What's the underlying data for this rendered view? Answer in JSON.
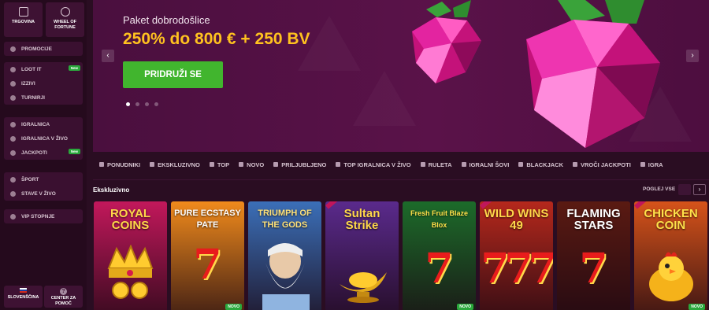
{
  "sidebar": {
    "top_tiles": [
      "TRGOVINA",
      "WHEEL OF FORTUNE"
    ],
    "groups": [
      [
        {
          "label": "PROMOCIJE",
          "icon": "gift-icon"
        }
      ],
      [
        {
          "label": "LOOT IT",
          "icon": "chest-icon",
          "badge": "New"
        },
        {
          "label": "IZZIVI",
          "icon": "target-icon"
        },
        {
          "label": "TURNIRJI",
          "icon": "trophy-icon"
        }
      ],
      [
        {
          "label": "IGRALNICA",
          "icon": "cards-icon"
        },
        {
          "label": "IGRALNICA V ŽIVO",
          "icon": "live-icon"
        },
        {
          "label": "JACKPOTI",
          "icon": "coins-icon",
          "badge": "New"
        }
      ],
      [
        {
          "label": "ŠPORT",
          "icon": "ball-icon"
        },
        {
          "label": "STAVE V ŽIVO",
          "icon": "timer-icon"
        }
      ],
      [
        {
          "label": "VIP STOPNJE",
          "icon": "crown-icon"
        }
      ]
    ],
    "language": "SLOVENŠČINA",
    "help": "CENTER ZA POMOČ"
  },
  "banner": {
    "subtitle": "Paket dobrodošlice",
    "title": "250% do 800 € + 250 BV",
    "cta": "PRIDRUŽI SE",
    "slides": 4,
    "active_slide": 1
  },
  "categories": [
    "PONUDNIKI",
    "EKSKLUZIVNO",
    "TOP",
    "NOVO",
    "PRILJUBLJENO",
    "TOP IGRALNICA V ŽIVO",
    "RULETA",
    "IGRALNI ŠOVI",
    "BLACKJACK",
    "VROČI JACKPOTI",
    "IGRA"
  ],
  "section": {
    "title": "Ekskluzivno",
    "see_all": "POGLEJ VSE"
  },
  "games": [
    {
      "name": "ROYAL COINS",
      "badge": "",
      "bg": "#c2185b"
    },
    {
      "name": "PURE ECSTASY PATE",
      "badge": "NOVO",
      "bg": "#f08a1c"
    },
    {
      "name": "TRIUMPH OF THE GODS",
      "badge": "",
      "bg": "#3b6fb8"
    },
    {
      "name": "Sultan Strike",
      "badge": "",
      "bg": "#5a2a8c"
    },
    {
      "name": "Fresh Fruit Blaze Blox",
      "badge": "NOVO",
      "bg": "#1c6b2a"
    },
    {
      "name": "WILD WINS 49",
      "badge": "",
      "bg": "#b5281c"
    },
    {
      "name": "FLAMING STARS",
      "badge": "",
      "bg": "#5a1a12"
    },
    {
      "name": "CHICKEN COIN",
      "badge": "NOVO",
      "bg": "#d6531a"
    }
  ],
  "colors": {
    "accent": "#ffc21f",
    "cta": "#41b52e",
    "badge": "#2aa83c"
  }
}
